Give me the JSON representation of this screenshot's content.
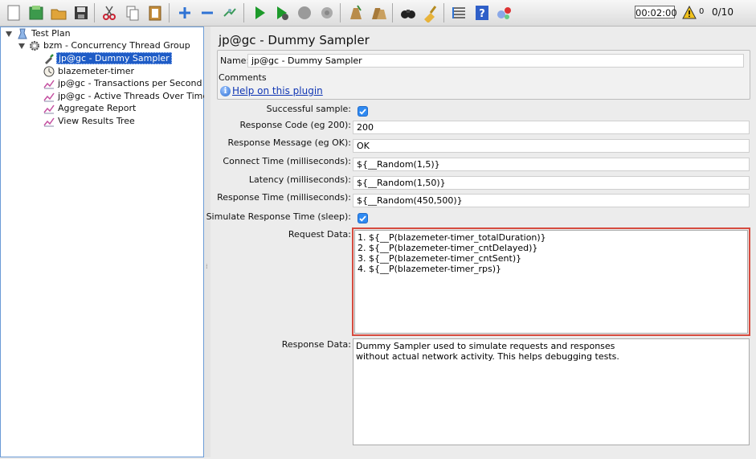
{
  "toolbar": {
    "timer": "00:02:00",
    "warnings": "0",
    "threads": "0/10",
    "buttons": [
      "new",
      "templates",
      "open",
      "save",
      "cut",
      "copy",
      "paste",
      "expand",
      "collapse",
      "toggle",
      "start",
      "start-no-pauses",
      "stop",
      "shutdown",
      "clear",
      "clear-all",
      "search",
      "reset-search",
      "function-helper",
      "help",
      "remote"
    ]
  },
  "tree": {
    "items": [
      {
        "label": "Test Plan",
        "icon": "test-plan-icon"
      },
      {
        "label": "bzm - Concurrency Thread Group",
        "icon": "gear-icon"
      },
      {
        "label": "jp@gc - Dummy Sampler",
        "icon": "dropper-icon",
        "selected": true
      },
      {
        "label": "blazemeter-timer",
        "icon": "timer-icon"
      },
      {
        "label": "jp@gc - Transactions per Second",
        "icon": "graph-icon"
      },
      {
        "label": "jp@gc - Active Threads Over Time",
        "icon": "graph-icon"
      },
      {
        "label": "Aggregate Report",
        "icon": "graph-icon"
      },
      {
        "label": "View Results Tree",
        "icon": "graph-icon"
      }
    ]
  },
  "panel": {
    "title": "jp@gc - Dummy Sampler",
    "name_label": "Name:",
    "name_value": "jp@gc - Dummy Sampler",
    "comments_label": "Comments:",
    "help_link": "Help on this plugin",
    "fields": {
      "successful_label": "Successful sample:",
      "response_code_label": "Response Code (eg 200):",
      "response_code": "200",
      "response_message_label": "Response Message (eg OK):",
      "response_message": "OK",
      "connect_time_label": "Connect Time (milliseconds):",
      "connect_time": "${__Random(1,5)}",
      "latency_label": "Latency (milliseconds):",
      "latency": "${__Random(1,50)}",
      "response_time_label": "Response Time (milliseconds):",
      "response_time": "${__Random(450,500)}",
      "simulate_label": "Simulate Response Time (sleep):",
      "request_data_label": "Request Data:",
      "request_data": "1. ${__P(blazemeter-timer_totalDuration)}\n2. ${__P(blazemeter-timer_cntDelayed)}\n3. ${__P(blazemeter-timer_cntSent)}\n4. ${__P(blazemeter-timer_rps)}",
      "response_data_label": "Response Data:",
      "response_data": "Dummy Sampler used to simulate requests and responses\nwithout actual network activity. This helps debugging tests."
    }
  },
  "colors": {
    "selection": "#1f5cc6",
    "highlight_border": "#d64b3f",
    "link": "#1036b4"
  }
}
